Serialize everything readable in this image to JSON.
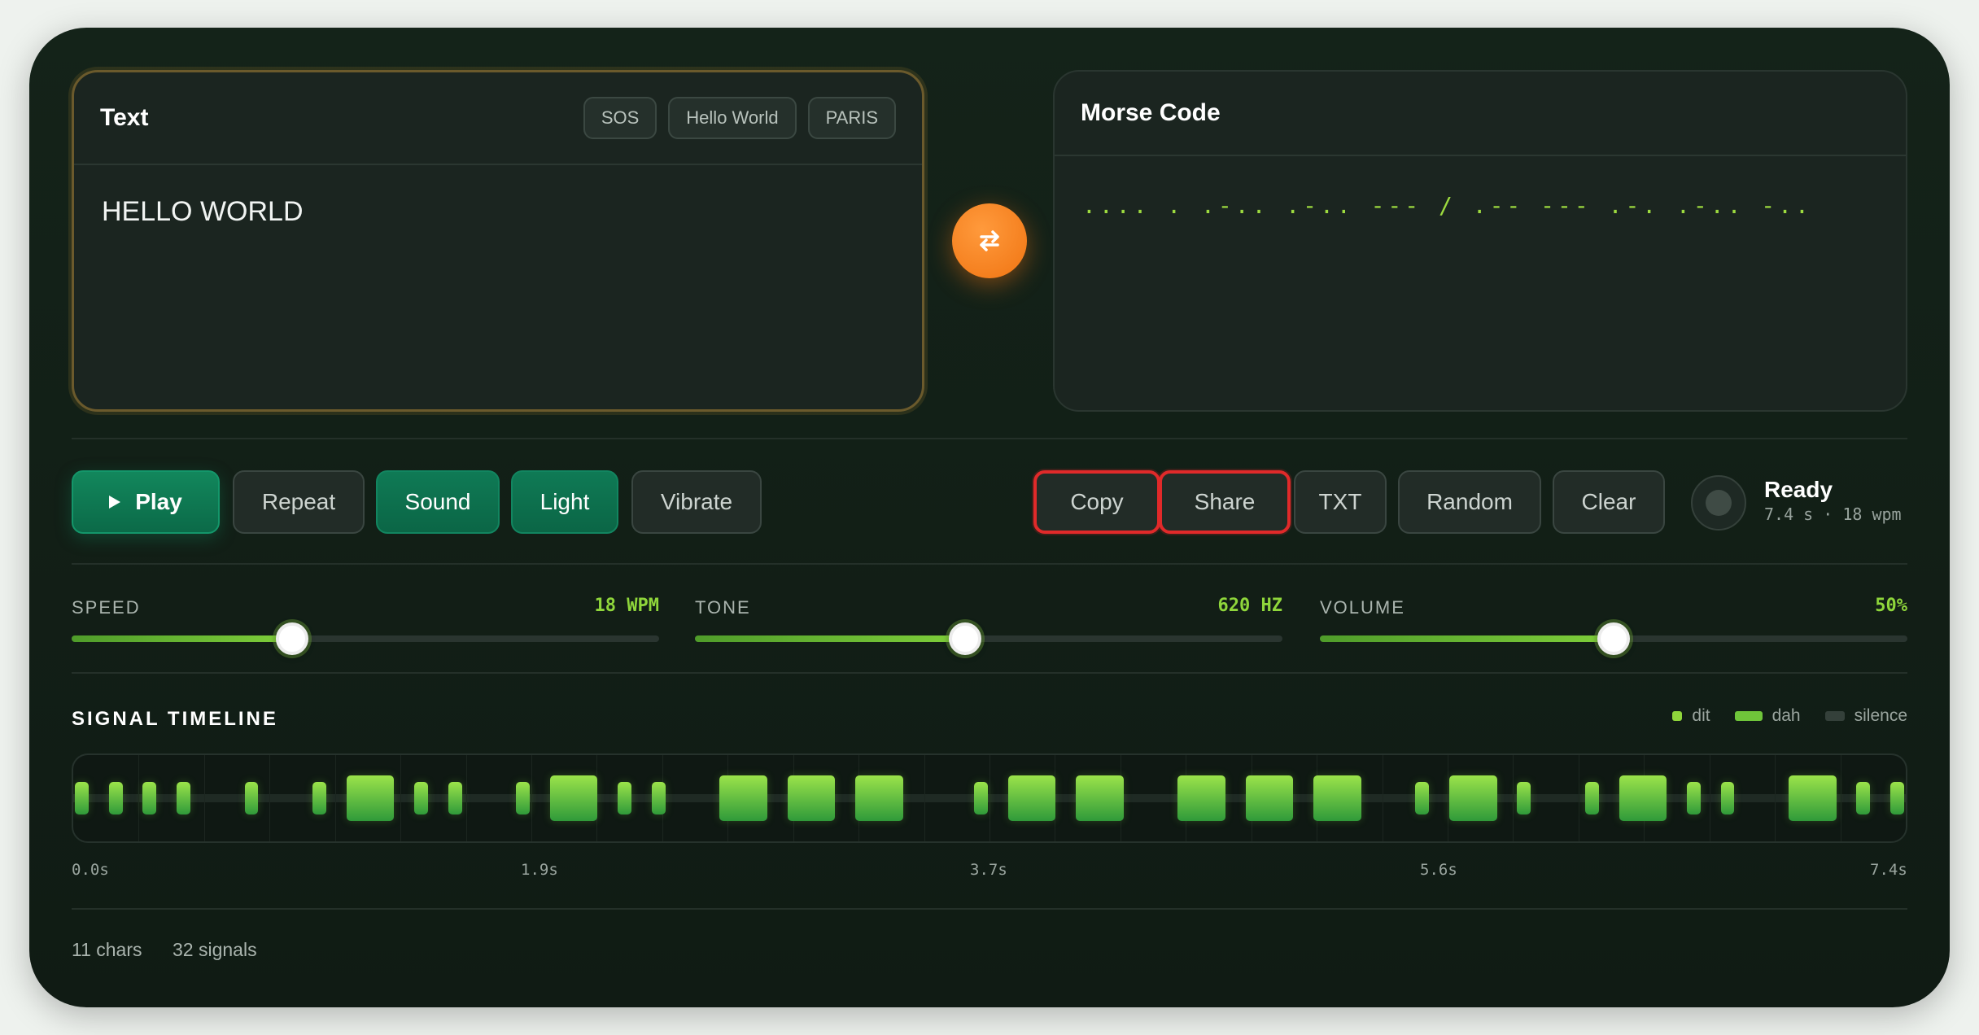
{
  "text_panel": {
    "title": "Text",
    "presets": [
      "SOS",
      "Hello World",
      "PARIS"
    ],
    "value": "HELLO WORLD"
  },
  "morse_panel": {
    "title": "Morse Code",
    "value": ".... . .-.. .-.. --- / .-- --- .-. .-.. -.."
  },
  "swap_icon": "swap-arrows-icon",
  "controls": {
    "play": "Play",
    "repeat": "Repeat",
    "sound": "Sound",
    "light": "Light",
    "vibrate": "Vibrate",
    "copy": "Copy",
    "share": "Share",
    "txt": "TXT",
    "random": "Random",
    "clear": "Clear"
  },
  "status": {
    "title": "Ready",
    "subtitle": "7.4 s · 18 wpm"
  },
  "sliders": [
    {
      "label": "SPEED",
      "value_text": "18 WPM",
      "fraction": 0.375
    },
    {
      "label": "TONE",
      "value_text": "620 HZ",
      "fraction": 0.46
    },
    {
      "label": "VOLUME",
      "value_text": "50%",
      "fraction": 0.5
    }
  ],
  "timeline": {
    "title": "SIGNAL TIMELINE",
    "legend": [
      "dit",
      "dah",
      "silence"
    ],
    "times": [
      "0.0s",
      "1.9s",
      "3.7s",
      "5.6s",
      "7.4s"
    ],
    "signals": [
      "dit",
      "dit",
      "dit",
      "dit",
      "dit",
      "dit",
      "dah",
      "dit",
      "dit",
      "dit",
      "dah",
      "dit",
      "dit",
      "dah",
      "dah",
      "dah",
      "dit",
      "dah",
      "dah",
      "dah",
      "dah",
      "dah",
      "dit",
      "dah",
      "dit",
      "dit",
      "dah",
      "dit",
      "dit",
      "dah",
      "dit",
      "dit"
    ]
  },
  "footer": {
    "chars": "11 chars",
    "signals": "32 signals"
  },
  "colors": {
    "accent_green": "#8fd63b",
    "swap_orange": "#f07412",
    "highlight_red": "#e02a2a"
  }
}
